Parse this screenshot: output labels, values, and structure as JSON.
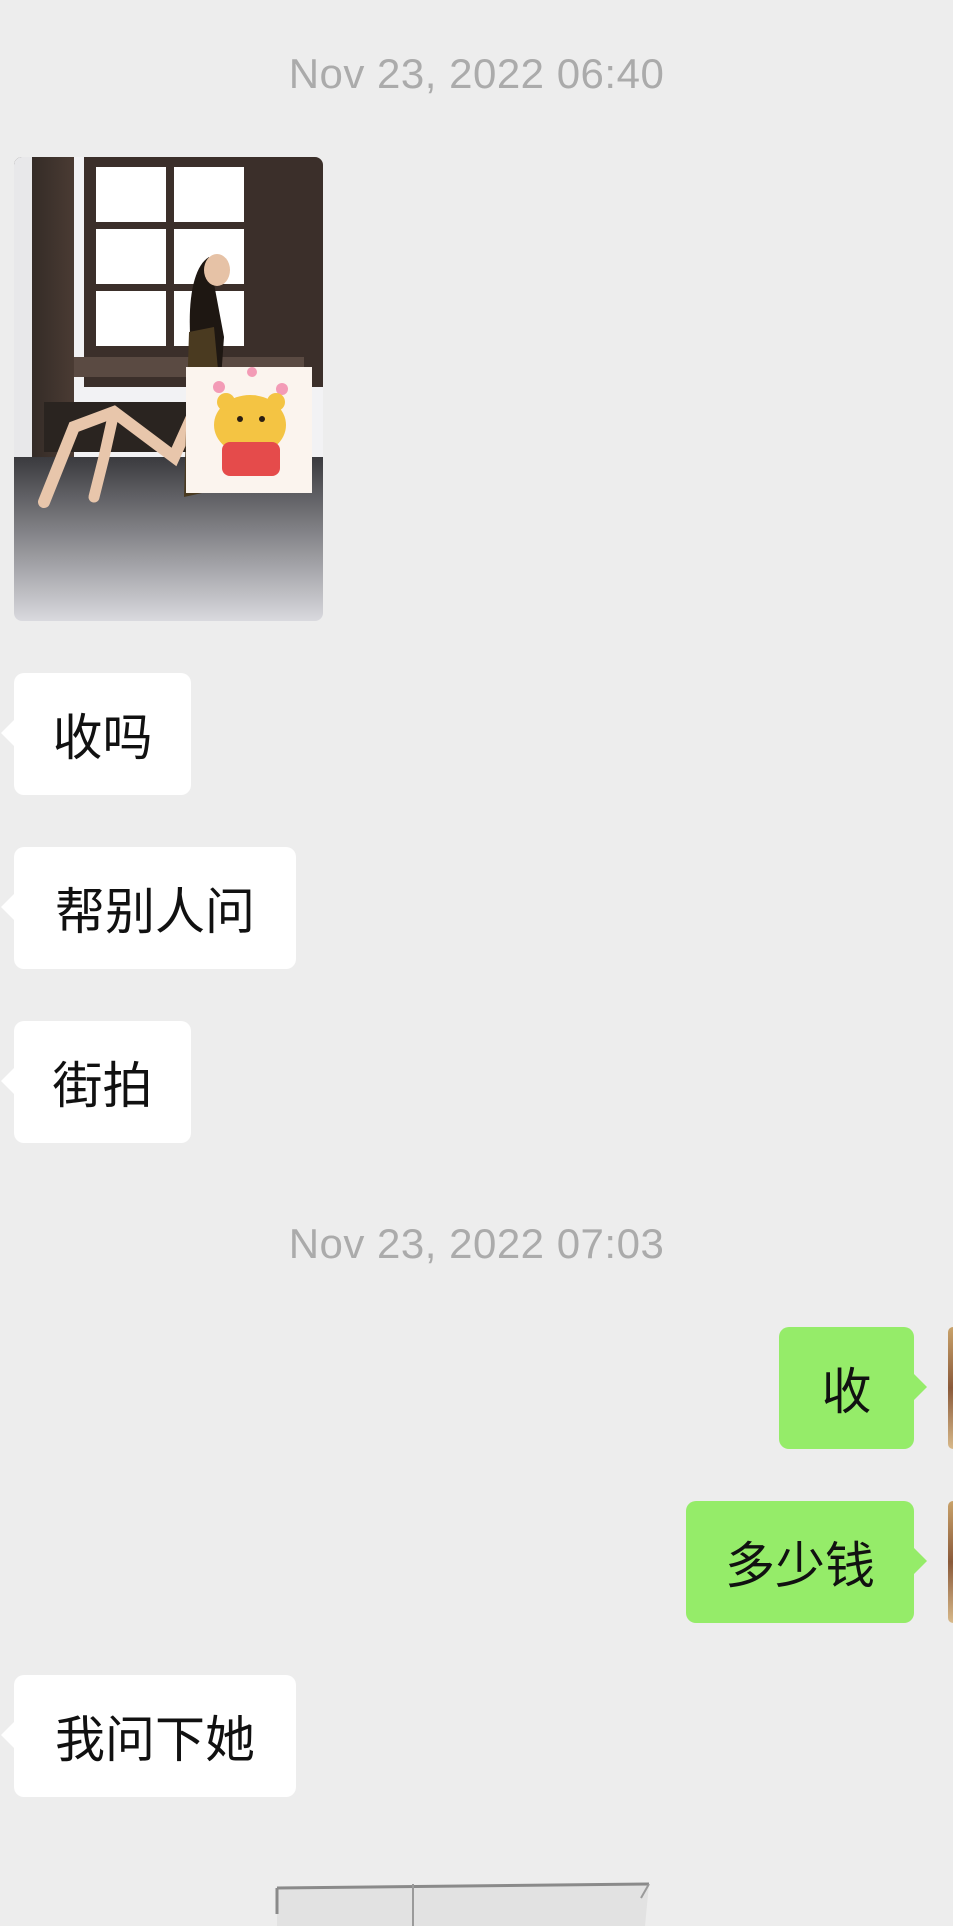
{
  "chat": {
    "timestamps": [
      "Nov 23, 2022 06:40",
      "Nov 23, 2022 07:03"
    ],
    "messages": [
      {
        "sender": "other",
        "type": "image"
      },
      {
        "sender": "other",
        "type": "text",
        "text": "收吗"
      },
      {
        "sender": "other",
        "type": "text",
        "text": "帮别人问"
      },
      {
        "sender": "other",
        "type": "text",
        "text": "街拍"
      },
      {
        "sender": "me",
        "type": "text",
        "text": "收"
      },
      {
        "sender": "me",
        "type": "text",
        "text": "多少钱"
      },
      {
        "sender": "other",
        "type": "text",
        "text": "我问下她"
      },
      {
        "sender": "other",
        "type": "image"
      }
    ]
  },
  "colors": {
    "background": "#ededed",
    "incoming_bubble": "#ffffff",
    "outgoing_bubble": "#95ec69",
    "timestamp_text": "#ababab"
  }
}
